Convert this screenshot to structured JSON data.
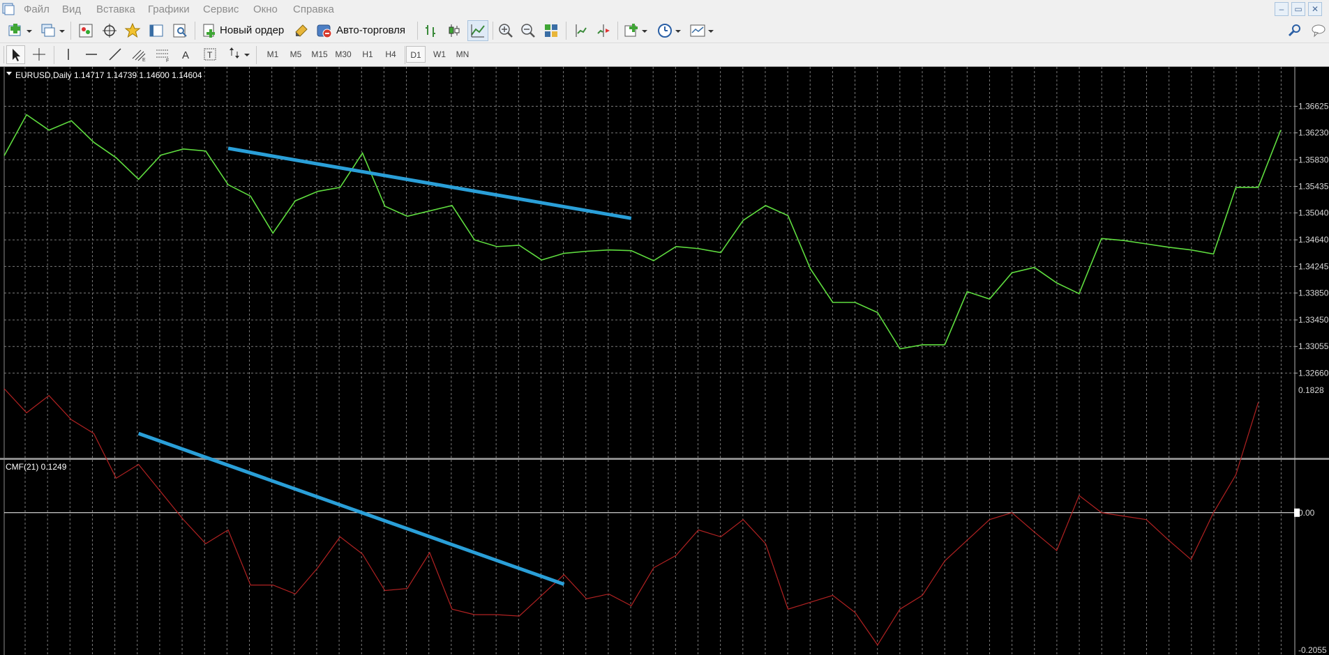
{
  "menu": {
    "items": [
      "Файл",
      "Вид",
      "Вставка",
      "Графики",
      "Сервис",
      "Окно",
      "Справка"
    ]
  },
  "toolbar": {
    "new_order_label": "Новый ордер",
    "auto_trading_label": "Авто-торговля",
    "timeframes": [
      "M1",
      "M5",
      "M15",
      "M30",
      "H1",
      "H4",
      "D1",
      "W1",
      "MN"
    ],
    "active_timeframe": "D1"
  },
  "chart": {
    "info_label": "EURUSD,Daily  1.14717  1.14739  1.14600  1.14604",
    "indicator_label": "CMF(21)  0.1249",
    "colors": {
      "background": "#000000",
      "grid": "#7a7a7a",
      "price_line": "#5fdd3f",
      "cmf_line": "#b22222",
      "trendline": "#2a9fd8",
      "zero_line": "#ffffff"
    }
  },
  "chart_data": [
    {
      "type": "line",
      "symbol": "EURUSD",
      "timeframe": "Daily",
      "y_ticks": [
        "1.36625",
        "1.36230",
        "1.35830",
        "1.35435",
        "1.35040",
        "1.34640",
        "1.34245",
        "1.33850",
        "1.33450",
        "1.33055",
        "1.32660"
      ],
      "ylim": [
        1.3255,
        1.369
      ],
      "series": [
        {
          "values": [
            1.3589,
            1.365,
            1.3627,
            1.3641,
            1.3609,
            1.3586,
            1.3554,
            1.359,
            1.3599,
            1.3596,
            1.3546,
            1.3529,
            1.3474,
            1.3522,
            1.3536,
            1.3542,
            1.3593,
            1.3514,
            1.3499,
            1.3507,
            1.3515,
            1.3464,
            1.3454,
            1.3456,
            1.3434,
            1.3444,
            1.3447,
            1.3449,
            1.3448,
            1.3433,
            1.3454,
            1.3451,
            1.3445,
            1.3493,
            1.3515,
            1.35,
            1.3421,
            1.3371,
            1.3371,
            1.3356,
            1.3302,
            1.3308,
            1.3308,
            1.3387,
            1.3376,
            1.3415,
            1.3423,
            1.34,
            1.3384,
            1.3466,
            1.3463,
            1.3458,
            1.3453,
            1.3449,
            1.3443,
            1.3542,
            1.3542,
            1.3627
          ]
        }
      ],
      "trendline": {
        "from": [
          10,
          1.36
        ],
        "to": [
          28,
          1.3496
        ]
      }
    },
    {
      "type": "line",
      "name": "CMF(21)",
      "y_ticks": [
        "0.1828",
        "0.00",
        "-0.2055"
      ],
      "ylim": [
        -0.2055,
        0.1828
      ],
      "series": [
        {
          "values": [
            0.18,
            0.145,
            0.17,
            0.135,
            0.115,
            0.05,
            0.07,
            0.03,
            -0.01,
            -0.045,
            -0.025,
            -0.105,
            -0.105,
            -0.118,
            -0.08,
            -0.035,
            -0.06,
            -0.113,
            -0.11,
            -0.058,
            -0.14,
            -0.148,
            -0.148,
            -0.15,
            -0.12,
            -0.09,
            -0.125,
            -0.118,
            -0.135,
            -0.08,
            -0.062,
            -0.025,
            -0.035,
            -0.01,
            -0.045,
            -0.14,
            -0.13,
            -0.12,
            -0.145,
            -0.192,
            -0.14,
            -0.12,
            -0.07,
            -0.04,
            -0.01,
            0.0,
            -0.028,
            -0.055,
            0.025,
            0.0,
            -0.005,
            -0.01,
            -0.04,
            -0.068,
            0.0,
            0.055,
            0.16
          ]
        }
      ],
      "trendline": {
        "from": [
          6,
          0.1149
        ],
        "to": [
          25,
          -0.1039
        ]
      }
    }
  ]
}
